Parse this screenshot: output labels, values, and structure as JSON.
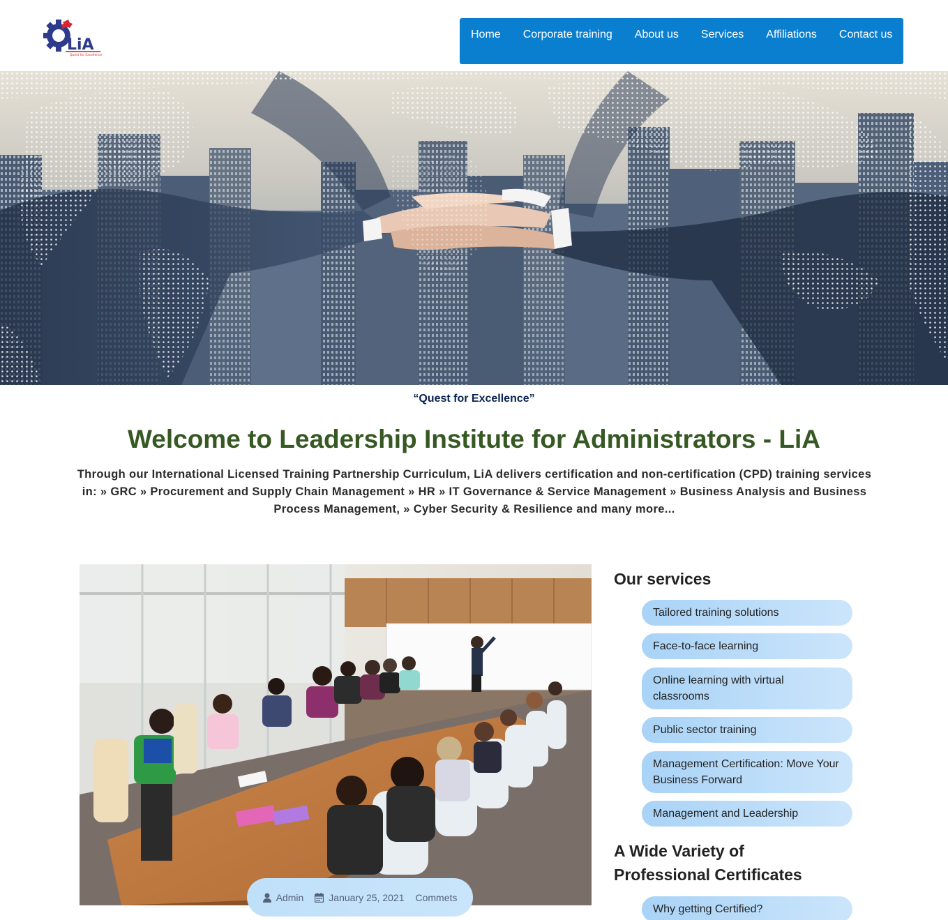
{
  "header": {
    "logo_text": "LiA",
    "logo_tagline": "Quest for Excellence",
    "nav": [
      "Home",
      "Corporate training",
      "About us",
      "Services",
      "Affiliations",
      "Contact us"
    ]
  },
  "hero": {
    "alt": "Business people stacking hands over city skyline"
  },
  "tagline": "“Quest for Excellence”",
  "welcome": "Welcome to Leadership Institute for Administrators - LiA",
  "intro": "Through our International Licensed Training Partnership Curriculum, LiA delivers certification and non-certification (CPD) training services in: » GRC » Procurement and Supply Chain Management » HR » IT Governance & Service Management » Business Analysis and Business Process Management, » Cyber Security & Resilience and many more...",
  "post": {
    "author": "Admin",
    "date": "January 25, 2021",
    "comments": "Commets"
  },
  "sidebar": {
    "services_title": "Our services",
    "services": [
      "Tailored training solutions",
      "Face-to-face learning",
      "Online learning with virtual classrooms",
      "Public sector training",
      "Management Certification: Move Your Business Forward",
      "Management and Leadership"
    ],
    "certs_title": "A Wide Variety of Professional Certificates",
    "certs": [
      "Why getting Certified?"
    ]
  },
  "colors": {
    "nav_bg": "#0a7fd0",
    "welcome": "#365823",
    "tagline": "#0a2350",
    "pill_start": "#a9d3f7",
    "pill_end": "#cbe5fb"
  }
}
